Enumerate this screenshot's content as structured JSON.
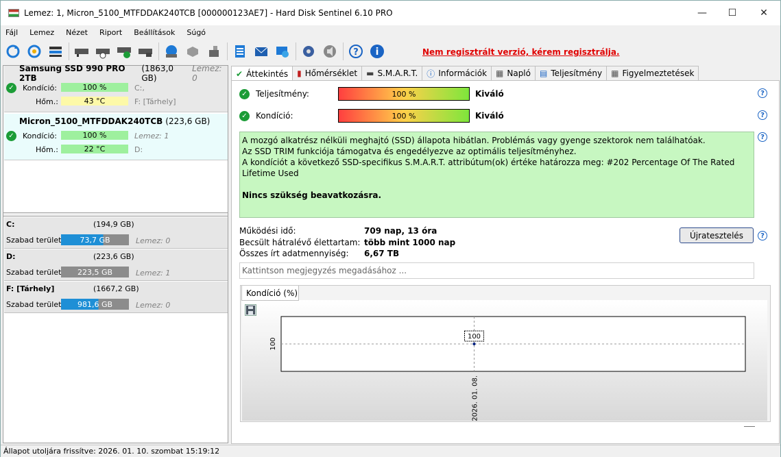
{
  "window": {
    "title": "Lemez: 1, Micron_5100_MTFDDAK240TCB [000000123AE7]  -  Hard Disk Sentinel 6.10 PRO"
  },
  "menu": [
    "Fájl",
    "Lemez",
    "Nézet",
    "Riport",
    "Beállítások",
    "Súgó"
  ],
  "toolbar": {
    "unregistered": "Nem regisztrált verzió, kérem regisztrálja."
  },
  "disks": [
    {
      "name": "Samsung SSD 990 PRO 2TB",
      "size": "(1863,0 GB)",
      "lemez": "Lemez: 0",
      "condition_label": "Kondíció:",
      "condition": "100 %",
      "condition_vol": "C:,",
      "temp_label": "Hőm.:",
      "temp": "43 °C",
      "temp_vol": "F: [Tárhely]"
    },
    {
      "name": "Micron_5100_MTFDDAK240TCB",
      "size": "(223,6 GB)",
      "condition_label": "Kondíció:",
      "condition": "100 %",
      "condition_vol": "Lemez: 1",
      "temp_label": "Hőm.:",
      "temp": "22 °C",
      "temp_vol": "D:"
    }
  ],
  "volumes": [
    {
      "name": "C:",
      "size": "(194,9 GB)",
      "free_label": "Szabad terület",
      "free": "73,7 GB",
      "disk": "Lemez: 0",
      "color": "#1e8fd6"
    },
    {
      "name": "D:",
      "size": "(223,6 GB)",
      "free_label": "Szabad terület",
      "free": "223,5 GB",
      "disk": "Lemez: 1",
      "color": "#8c8c8c"
    },
    {
      "name": "F: [Tárhely]",
      "size": "(1667,2 GB)",
      "free_label": "Szabad terület",
      "free": "981,6 GB",
      "disk": "Lemez: 0",
      "color": "#1e8fd6"
    }
  ],
  "tabs": [
    "Áttekintés",
    "Hőmérséklet",
    "S.M.A.R.T.",
    "Információk",
    "Napló",
    "Teljesítmény",
    "Figyelmeztetések"
  ],
  "overview": {
    "performance_label": "Teljesítmény:",
    "performance_value": "100 %",
    "performance_text": "Kiváló",
    "condition_label": "Kondíció:",
    "condition_value": "100 %",
    "condition_text": "Kiváló",
    "info_lines": [
      "A mozgó alkatrész nélküli meghajtó (SSD) állapota hibátlan. Problémás vagy gyenge szektorok nem találhatóak.",
      "Az SSD TRIM funkciója támogatva és engedélyezve az optimális teljesítményhez.",
      "A kondíciót a következő SSD-specifikus S.M.A.R.T. attribútum(ok) értéke határozza meg:  #202 Percentage Of The Rated Lifetime Used"
    ],
    "info_bold": "Nincs szükség beavatkozásra.",
    "uptime_label": "Működési idő:",
    "uptime": "709 nap, 13 óra",
    "remaining_label": "Becsült hátralévő élettartam:",
    "remaining": "több mint 1000 nap",
    "written_label": "Összes írt adatmennyiség:",
    "written": "6,67 TB",
    "retest_button": "Újratesztelés",
    "note_placeholder": "Kattintson megjegyzés megadásához ..."
  },
  "chart_tab": "Kondíció  (%)",
  "chart_data": {
    "type": "line",
    "x": [
      "2026. 01. 08."
    ],
    "series": [
      {
        "values": [
          100
        ]
      }
    ],
    "ylabel_ticks": [
      "100"
    ],
    "data_labels": [
      "100"
    ]
  },
  "status": "Állapot utoljára frissítve: 2026. 01. 10. szombat 15:19:12"
}
